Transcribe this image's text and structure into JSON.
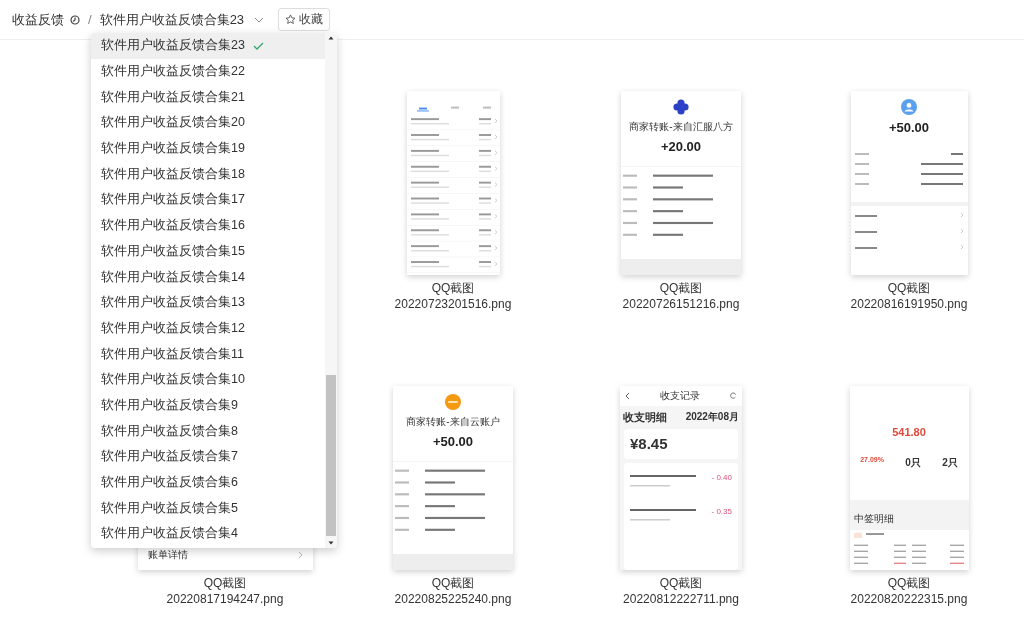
{
  "breadcrumb": {
    "parent": "收益反馈",
    "separator": "/",
    "current": "软件用户收益反馈合集23"
  },
  "favorite_button": {
    "label": "收藏"
  },
  "menu": {
    "items": [
      {
        "label": "软件用户收益反馈合集23",
        "selected": true
      },
      {
        "label": "软件用户收益反馈合集22",
        "selected": false
      },
      {
        "label": "软件用户收益反馈合集21",
        "selected": false
      },
      {
        "label": "软件用户收益反馈合集20",
        "selected": false
      },
      {
        "label": "软件用户收益反馈合集19",
        "selected": false
      },
      {
        "label": "软件用户收益反馈合集18",
        "selected": false
      },
      {
        "label": "软件用户收益反馈合集17",
        "selected": false
      },
      {
        "label": "软件用户收益反馈合集16",
        "selected": false
      },
      {
        "label": "软件用户收益反馈合集15",
        "selected": false
      },
      {
        "label": "软件用户收益反馈合集14",
        "selected": false
      },
      {
        "label": "软件用户收益反馈合集13",
        "selected": false
      },
      {
        "label": "软件用户收益反馈合集12",
        "selected": false
      },
      {
        "label": "软件用户收益反馈合集11",
        "selected": false
      },
      {
        "label": "软件用户收益反馈合集10",
        "selected": false
      },
      {
        "label": "软件用户收益反馈合集9",
        "selected": false
      },
      {
        "label": "软件用户收益反馈合集8",
        "selected": false
      },
      {
        "label": "软件用户收益反馈合集7",
        "selected": false
      },
      {
        "label": "软件用户收益反馈合集6",
        "selected": false
      },
      {
        "label": "软件用户收益反馈合集5",
        "selected": false
      },
      {
        "label": "软件用户收益反馈合集4",
        "selected": false
      }
    ]
  },
  "files": [
    {
      "caption": "QQ截图",
      "filename": "20220723201516.png",
      "thumb": {
        "kind": "list"
      }
    },
    {
      "caption": "QQ截图",
      "filename": "20220726151216.png",
      "thumb": {
        "kind": "receipt",
        "logo": {
          "kind": "flower"
        },
        "title": "商家转账-来自汇服八方",
        "amount": "+20.00"
      }
    },
    {
      "caption": "QQ截图",
      "filename": "20220816191950.png",
      "thumb": {
        "kind": "profile",
        "amount": "+50.00"
      }
    },
    {
      "caption": "QQ截图",
      "filename": "20220817194247.png",
      "thumb": {
        "kind": "bill",
        "row": "账单详情"
      }
    },
    {
      "caption": "QQ截图",
      "filename": "20220825225240.png",
      "thumb": {
        "kind": "receipt",
        "logo": {
          "kind": "badge"
        },
        "title": "商家转账-来自云账户",
        "amount": "+50.00"
      }
    },
    {
      "caption": "QQ截图",
      "filename": "20220812222711.png",
      "thumb": {
        "kind": "ledger",
        "header": "收支记录",
        "title": "收支明细",
        "month": "2022年08月",
        "balance": "¥8.45",
        "entries": [
          "- 0.40",
          "- 0.35"
        ]
      }
    },
    {
      "caption": "QQ截图",
      "filename": "20220820222315.png",
      "thumb": {
        "kind": "stats",
        "total": "541.80",
        "rate": "27.09%",
        "counts": [
          "0只",
          "2只"
        ],
        "section": "中签明细"
      }
    }
  ]
}
